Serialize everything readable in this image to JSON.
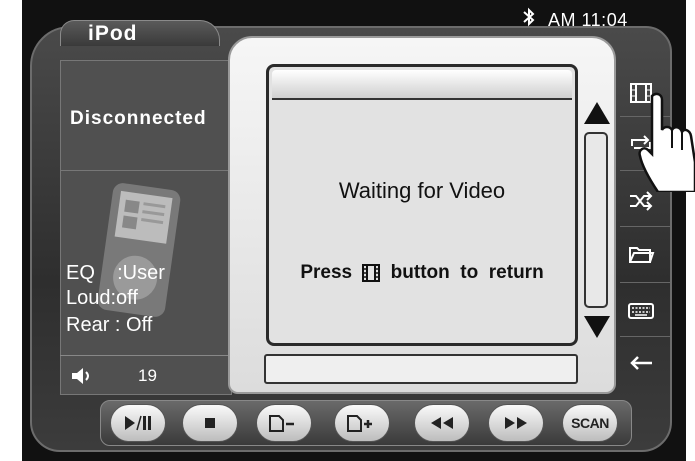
{
  "status_bar": {
    "time": "AM 11:04",
    "bluetooth_icon": "bluetooth-icon"
  },
  "source": {
    "title": "iPod"
  },
  "left_panel": {
    "connection_status": "Disconnected",
    "eq": "EQ    :User",
    "loud": "Loud:off",
    "rear": "Rear : Off",
    "volume": "19",
    "volume_icon": "speaker-icon",
    "art_icon": "ipod-device-icon"
  },
  "video": {
    "message": "Waiting for Video",
    "hint_before": "Press",
    "hint_icon": "film-icon",
    "hint_after": "button  to  return"
  },
  "side_menu": [
    {
      "name": "video-mode-button",
      "icon": "film-icon"
    },
    {
      "name": "repeat-button",
      "icon": "repeat-icon"
    },
    {
      "name": "shuffle-button",
      "icon": "shuffle-icon"
    },
    {
      "name": "folder-button",
      "icon": "folder-icon"
    },
    {
      "name": "keyboard-button",
      "icon": "keyboard-icon"
    },
    {
      "name": "back-button",
      "icon": "arrow-left-icon"
    }
  ],
  "transport": {
    "buttons": [
      "play-pause-icon",
      "stop-icon",
      "page-minus-icon",
      "page-plus-icon",
      "rewind-icon",
      "fast-forward-icon"
    ],
    "scan_label": "SCAN"
  },
  "colors": {
    "background": "#111111",
    "panel": "#505050",
    "video_bg": "#e2e2e2",
    "text_light": "#ffffff",
    "text_dark": "#111111"
  }
}
